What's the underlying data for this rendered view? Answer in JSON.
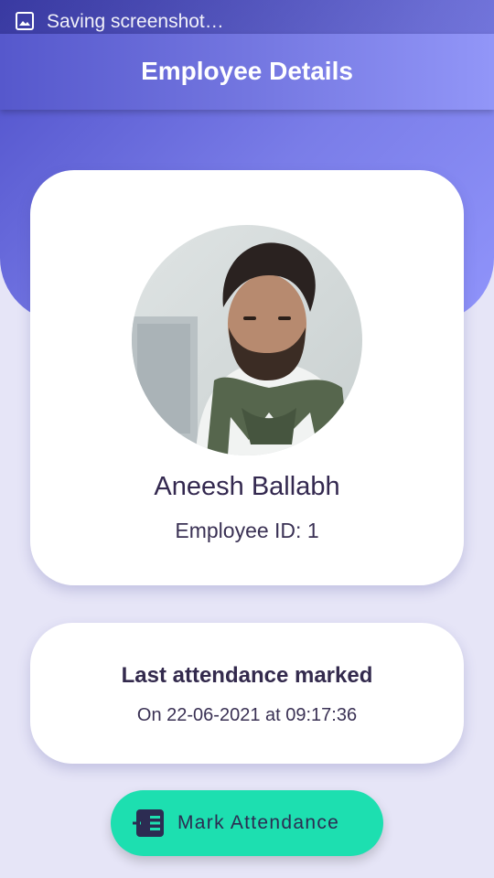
{
  "status_bar": {
    "notification_icon": "image-icon",
    "text": "Saving screenshot…"
  },
  "app_bar": {
    "title": "Employee Details"
  },
  "profile": {
    "avatar_icon": "employee-photo",
    "name": "Aneesh Ballabh",
    "employee_id": "Employee ID: 1"
  },
  "attendance": {
    "title": "Last attendance marked",
    "timestamp": "On 22-06-2021 at 09:17:36"
  },
  "mark_button": {
    "icon": "attendance-list-icon",
    "label": "Mark Attendance"
  },
  "colors": {
    "primary_gradient_start": "#4d4ec8",
    "primary_gradient_end": "#9094fb",
    "page_background": "#e6e5f7",
    "button_green": "#1ddfb0",
    "text_dark": "#33284f"
  }
}
